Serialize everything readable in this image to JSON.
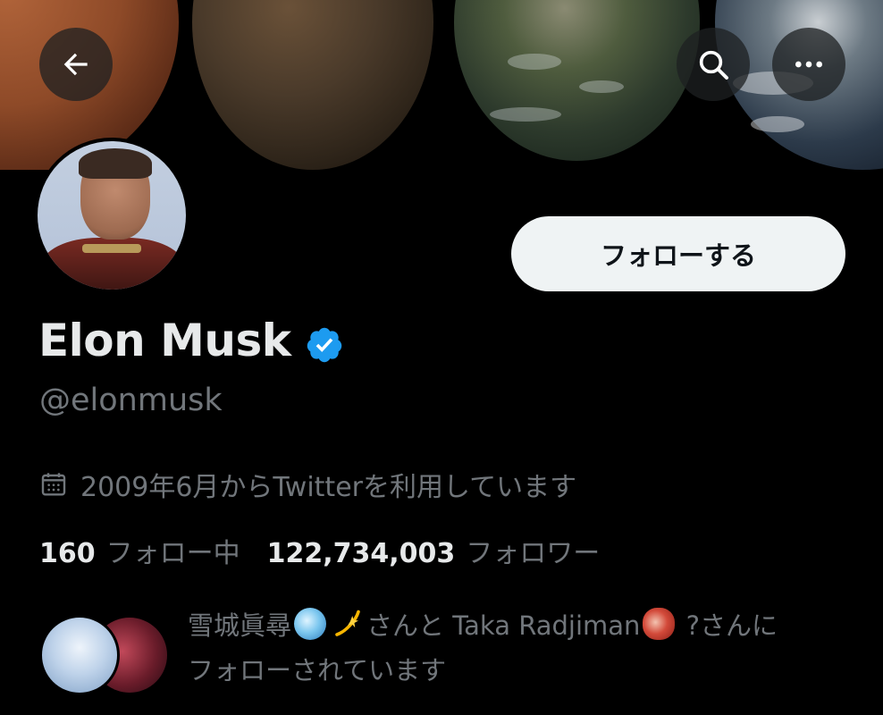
{
  "header": {
    "back_icon": "arrow-left-icon",
    "search_icon": "search-icon",
    "more_icon": "more-horizontal-icon"
  },
  "profile": {
    "display_name": "Elon Musk",
    "verified_icon": "verified-badge-icon",
    "verified_color": "#1d9bf0",
    "handle": "@elonmusk",
    "follow_label": "フォローする",
    "joined_text": "2009年6月からTwitterを利用しています",
    "calendar_icon": "calendar-icon"
  },
  "stats": {
    "following_count": "160",
    "following_label": "フォロー中",
    "followers_count": "122,734,003",
    "followers_label": "フォロワー"
  },
  "followed_by": {
    "user1": "雪城眞尋",
    "between": "さんと",
    "user2": "Taka Radjiman",
    "end": "?さんに",
    "line2": "フォローされています"
  },
  "colors": {
    "background": "#000000",
    "primary_text": "#e7e9ea",
    "secondary_text": "#71767b",
    "follow_button_bg": "#eff3f4"
  }
}
